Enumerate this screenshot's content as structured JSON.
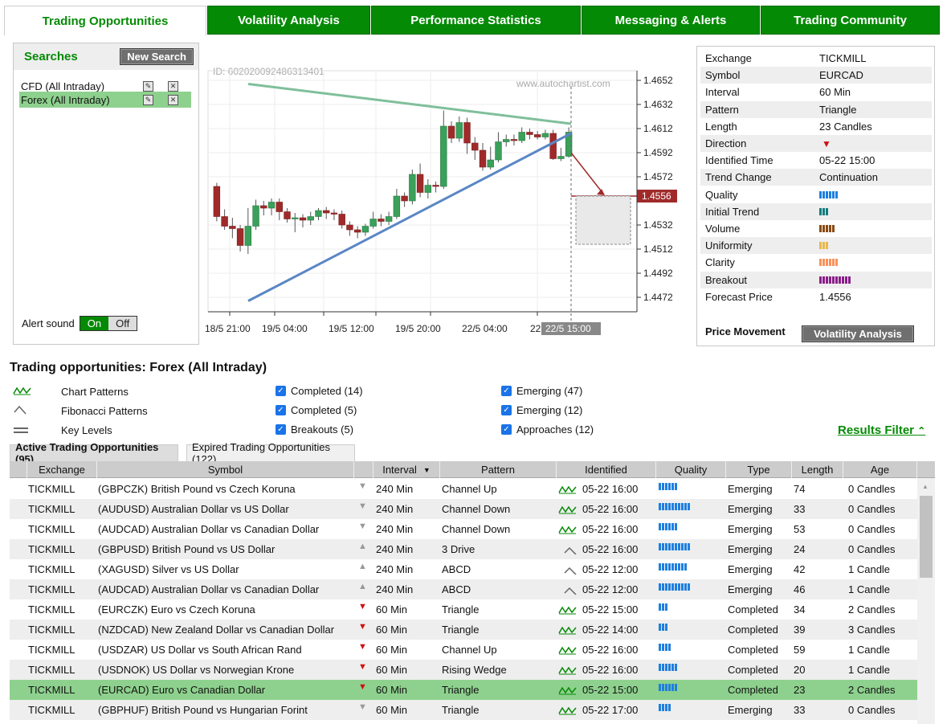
{
  "tabs": [
    "Trading Opportunities",
    "Volatility Analysis",
    "Performance Statistics",
    "Messaging & Alerts",
    "Trading Community"
  ],
  "searches": {
    "title": "Searches",
    "new_search": "New Search",
    "items": [
      "CFD (All Intraday)",
      "Forex (All Intraday)"
    ],
    "alert_label": "Alert sound",
    "on": "On",
    "off": "Off"
  },
  "chart": {
    "id_text": "ID: 602020092486313401",
    "watermark": "www.autochartist.com",
    "price_labels": [
      "1.4652",
      "1.4632",
      "1.4612",
      "1.4592",
      "1.4572",
      "1.4556",
      "1.4532",
      "1.4512",
      "1.4492",
      "1.4472"
    ],
    "time_labels": [
      "18/5 21:00",
      "19/5 04:00",
      "19/5 12:00",
      "19/5 20:00",
      "22/5 04:00",
      "22",
      "22/5 15:00"
    ]
  },
  "chart_data": {
    "type": "candlestick",
    "y_ticks": [
      1.4652,
      1.4632,
      1.4612,
      1.4592,
      1.4572,
      1.4552,
      1.4532,
      1.4512,
      1.4492,
      1.4472
    ],
    "x_ticks": [
      "18/5 21:00",
      "19/5 04:00",
      "19/5 12:00",
      "19/5 20:00",
      "22/5 04:00",
      "22/5 15:00"
    ],
    "forecast_price": 1.4556,
    "candles": [
      [
        1.4564,
        1.4539,
        1.4567,
        1.4535
      ],
      [
        1.4539,
        1.4531,
        1.4545,
        1.4528
      ],
      [
        1.4531,
        1.4529,
        1.4538,
        1.4521
      ],
      [
        1.4529,
        1.4515,
        1.4532,
        1.451
      ],
      [
        1.4515,
        1.4531,
        1.4546,
        1.4508
      ],
      [
        1.4531,
        1.4548,
        1.4553,
        1.4528
      ],
      [
        1.4548,
        1.4546,
        1.4552,
        1.454
      ],
      [
        1.4546,
        1.4551,
        1.4554,
        1.454
      ],
      [
        1.4551,
        1.4543,
        1.4554,
        1.4536
      ],
      [
        1.4543,
        1.4537,
        1.4546,
        1.4534
      ],
      [
        1.4537,
        1.4538,
        1.4542,
        1.4526
      ],
      [
        1.4538,
        1.4536,
        1.4541,
        1.453
      ],
      [
        1.4536,
        1.4539,
        1.4543,
        1.4532
      ],
      [
        1.4539,
        1.4544,
        1.4546,
        1.4536
      ],
      [
        1.4544,
        1.4542,
        1.4547,
        1.4537
      ],
      [
        1.4542,
        1.4541,
        1.4545,
        1.4536
      ],
      [
        1.4541,
        1.4532,
        1.4544,
        1.4529
      ],
      [
        1.4532,
        1.4528,
        1.4535,
        1.4523
      ],
      [
        1.4528,
        1.4526,
        1.4531,
        1.4521
      ],
      [
        1.4526,
        1.4531,
        1.4533,
        1.4523
      ],
      [
        1.4531,
        1.4537,
        1.4543,
        1.4529
      ],
      [
        1.4537,
        1.4535,
        1.4541,
        1.4531
      ],
      [
        1.4535,
        1.4539,
        1.4543,
        1.4532
      ],
      [
        1.4539,
        1.4556,
        1.4562,
        1.4537
      ],
      [
        1.4556,
        1.4552,
        1.4559,
        1.4547
      ],
      [
        1.4552,
        1.4574,
        1.4578,
        1.4549
      ],
      [
        1.4574,
        1.4559,
        1.4583,
        1.4555
      ],
      [
        1.4559,
        1.4565,
        1.457,
        1.4554
      ],
      [
        1.4565,
        1.4564,
        1.4568,
        1.4559
      ],
      [
        1.4564,
        1.4614,
        1.4627,
        1.4562
      ],
      [
        1.4614,
        1.4604,
        1.4618,
        1.46
      ],
      [
        1.4604,
        1.4617,
        1.4622,
        1.4601
      ],
      [
        1.4617,
        1.46,
        1.4621,
        1.4591
      ],
      [
        1.46,
        1.4594,
        1.4605,
        1.4586
      ],
      [
        1.4594,
        1.458,
        1.46,
        1.4577
      ],
      [
        1.458,
        1.4586,
        1.4597,
        1.4578
      ],
      [
        1.4586,
        1.4601,
        1.4609,
        1.4584
      ],
      [
        1.4601,
        1.4603,
        1.4607,
        1.4597
      ],
      [
        1.4603,
        1.4602,
        1.4607,
        1.4598
      ],
      [
        1.4602,
        1.4609,
        1.4613,
        1.46
      ],
      [
        1.4609,
        1.4607,
        1.4612,
        1.4603
      ],
      [
        1.4607,
        1.4605,
        1.461,
        1.4603
      ],
      [
        1.4605,
        1.4608,
        1.4611,
        1.4603
      ],
      [
        1.4608,
        1.4587,
        1.4611,
        1.4586
      ],
      [
        1.4587,
        1.4589,
        1.4596,
        1.4585
      ],
      [
        1.4589,
        1.4609,
        1.4613,
        1.4588
      ]
    ]
  },
  "info": {
    "rows": [
      {
        "label": "Exchange",
        "value": "TICKMILL"
      },
      {
        "label": "Symbol",
        "value": "EURCAD"
      },
      {
        "label": "Interval",
        "value": "60 Min"
      },
      {
        "label": "Pattern",
        "value": "Triangle"
      },
      {
        "label": "Length",
        "value": "23 Candles"
      },
      {
        "label": "Direction",
        "value": ""
      },
      {
        "label": "Identified Time",
        "value": "05-22 15:00"
      },
      {
        "label": "Trend Change",
        "value": "Continuation"
      },
      {
        "label": "Quality",
        "value": ""
      },
      {
        "label": "Initial Trend",
        "value": ""
      },
      {
        "label": "Volume",
        "value": ""
      },
      {
        "label": "Uniformity",
        "value": ""
      },
      {
        "label": "Clarity",
        "value": ""
      },
      {
        "label": "Breakout",
        "value": ""
      },
      {
        "label": "Forecast Price",
        "value": "1.4556"
      }
    ],
    "ratings": {
      "quality": 6,
      "initial_trend": 3,
      "volume": 5,
      "uniformity": 3,
      "clarity": 6,
      "breakout": 10
    },
    "rating_colors": {
      "quality": "#1e7fe0",
      "initial_trend": "#127d7d",
      "volume": "#8b4a12",
      "uniformity": "#e8b84a",
      "clarity": "#f9925a",
      "breakout": "#8a1e8a"
    },
    "price_movement": "Price Movement",
    "volatility_btn": "Volatility Analysis"
  },
  "section_title": "Trading opportunities: Forex (All Intraday)",
  "legend": {
    "types": [
      "Chart Patterns",
      "Fibonacci Patterns",
      "Key Levels"
    ],
    "completed": [
      "Completed (14)",
      "Completed (5)",
      "Breakouts (5)"
    ],
    "emerging": [
      "Emerging (47)",
      "Emerging (12)",
      "Approaches (12)"
    ]
  },
  "results_filter": "Results Filter",
  "table_tabs": [
    "Active Trading Opportunities (95)",
    "Expired Trading Opportunities (122)"
  ],
  "columns": [
    "Exchange",
    "Symbol",
    "Interval",
    "Pattern",
    "Identified",
    "Quality",
    "Type",
    "Length",
    "Age"
  ],
  "rows": [
    {
      "exchange": "TICKMILL",
      "symbol": "(GBPCZK) British Pound vs Czech Koruna",
      "dir": "down-grey",
      "interval": "240 Min",
      "pattern": "Channel Up",
      "picon": "chart",
      "identified": "05-22 16:00",
      "quality": 6,
      "type": "Emerging",
      "length": "74",
      "age": "0 Candles"
    },
    {
      "exchange": "TICKMILL",
      "symbol": "(AUDUSD) Australian Dollar vs US Dollar",
      "dir": "down-grey",
      "interval": "240 Min",
      "pattern": "Channel Down",
      "picon": "chart",
      "identified": "05-22 16:00",
      "quality": 10,
      "type": "Emerging",
      "length": "33",
      "age": "0 Candles"
    },
    {
      "exchange": "TICKMILL",
      "symbol": "(AUDCAD) Australian Dollar vs Canadian Dollar",
      "dir": "down-grey",
      "interval": "240 Min",
      "pattern": "Channel Down",
      "picon": "chart",
      "identified": "05-22 16:00",
      "quality": 6,
      "type": "Emerging",
      "length": "53",
      "age": "0 Candles"
    },
    {
      "exchange": "TICKMILL",
      "symbol": "(GBPUSD) British Pound vs US Dollar",
      "dir": "up-grey",
      "interval": "240 Min",
      "pattern": "3 Drive",
      "picon": "fib",
      "identified": "05-22 16:00",
      "quality": 10,
      "type": "Emerging",
      "length": "24",
      "age": "0 Candles"
    },
    {
      "exchange": "TICKMILL",
      "symbol": "(XAGUSD) Silver vs US Dollar",
      "dir": "up-grey",
      "interval": "240 Min",
      "pattern": "ABCD",
      "picon": "fib",
      "identified": "05-22 12:00",
      "quality": 9,
      "type": "Emerging",
      "length": "42",
      "age": "1 Candle"
    },
    {
      "exchange": "TICKMILL",
      "symbol": "(AUDCAD) Australian Dollar vs Canadian Dollar",
      "dir": "up-grey",
      "interval": "240 Min",
      "pattern": "ABCD",
      "picon": "fib",
      "identified": "05-22 12:00",
      "quality": 10,
      "type": "Emerging",
      "length": "46",
      "age": "1 Candle"
    },
    {
      "exchange": "TICKMILL",
      "symbol": "(EURCZK) Euro vs Czech Koruna",
      "dir": "down-red",
      "interval": "60 Min",
      "pattern": "Triangle",
      "picon": "chart",
      "identified": "05-22 15:00",
      "quality": 3,
      "type": "Completed",
      "length": "34",
      "age": "2 Candles"
    },
    {
      "exchange": "TICKMILL",
      "symbol": "(NZDCAD) New Zealand Dollar vs Canadian Dollar",
      "dir": "down-red",
      "interval": "60 Min",
      "pattern": "Triangle",
      "picon": "chart",
      "identified": "05-22 14:00",
      "quality": 3,
      "type": "Completed",
      "length": "39",
      "age": "3 Candles"
    },
    {
      "exchange": "TICKMILL",
      "symbol": "(USDZAR) US Dollar vs South African Rand",
      "dir": "down-red",
      "interval": "60 Min",
      "pattern": "Channel Up",
      "picon": "chart",
      "identified": "05-22 16:00",
      "quality": 4,
      "type": "Completed",
      "length": "59",
      "age": "1 Candle"
    },
    {
      "exchange": "TICKMILL",
      "symbol": "(USDNOK) US Dollar vs Norwegian Krone",
      "dir": "down-red",
      "interval": "60 Min",
      "pattern": "Rising Wedge",
      "picon": "chart",
      "identified": "05-22 16:00",
      "quality": 6,
      "type": "Completed",
      "length": "20",
      "age": "1 Candle"
    },
    {
      "exchange": "TICKMILL",
      "symbol": "(EURCAD) Euro vs Canadian Dollar",
      "dir": "down-red",
      "interval": "60 Min",
      "pattern": "Triangle",
      "picon": "chart",
      "identified": "05-22 15:00",
      "quality": 6,
      "type": "Completed",
      "length": "23",
      "age": "2 Candles",
      "selected": true
    },
    {
      "exchange": "TICKMILL",
      "symbol": "(GBPHUF) British Pound vs Hungarian Forint",
      "dir": "down-grey",
      "interval": "60 Min",
      "pattern": "Triangle",
      "picon": "chart",
      "identified": "05-22 17:00",
      "quality": 4,
      "type": "Emerging",
      "length": "33",
      "age": "0 Candles"
    }
  ]
}
